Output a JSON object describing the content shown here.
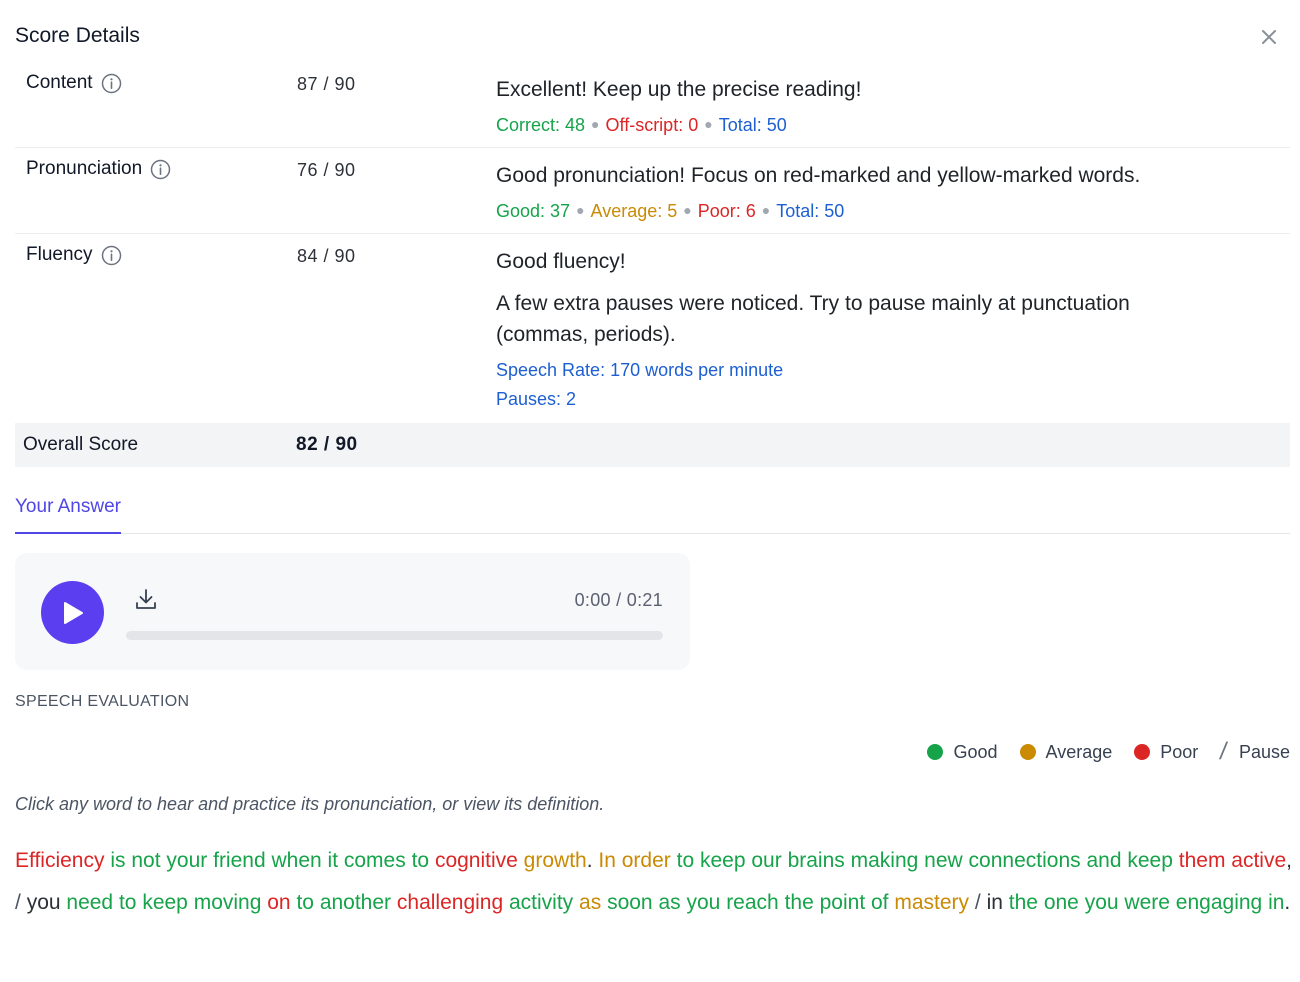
{
  "header": {
    "title": "Score Details",
    "close_icon": "close-icon"
  },
  "rows": {
    "content": {
      "label": "Content",
      "score": "87 / 90",
      "feedback": "Excellent! Keep up the precise reading!",
      "correct": "Correct: 48",
      "offscript": "Off-script: 0",
      "total": "Total: 50"
    },
    "pronunciation": {
      "label": "Pronunciation",
      "score": "76 / 90",
      "feedback": "Good pronunciation! Focus on red-marked and yellow-marked words.",
      "good": "Good: 37",
      "average": "Average: 5",
      "poor": "Poor: 6",
      "total": "Total: 50"
    },
    "fluency": {
      "label": "Fluency",
      "score": "84 / 90",
      "feedback": "Good fluency!",
      "detail": "A few extra pauses were noticed. Try to pause mainly at punctuation (commas, periods).",
      "rate": "Speech Rate: 170 words per minute",
      "pauses": "Pauses: 2"
    }
  },
  "overall": {
    "label": "Overall Score",
    "score": "82 / 90"
  },
  "tabs": {
    "answer": "Your Answer"
  },
  "player": {
    "time": "0:00 / 0:21",
    "progress": 0
  },
  "evaluation": {
    "title": "SPEECH EVALUATION",
    "legend": {
      "good": "Good",
      "average": "Average",
      "poor": "Poor",
      "pause": "Pause"
    },
    "hint": "Click any word to hear and practice its pronunciation, or view its definition."
  },
  "colors": {
    "good": "#16a34a",
    "average": "#ca8a04",
    "poor": "#dc2626",
    "accent": "#5b3ef0",
    "info": "#1d5fd1"
  },
  "passage": [
    {
      "t": "Efficiency",
      "c": "poor"
    },
    {
      "t": " "
    },
    {
      "t": "is",
      "c": "good"
    },
    {
      "t": " "
    },
    {
      "t": "not",
      "c": "good"
    },
    {
      "t": " "
    },
    {
      "t": "your",
      "c": "good"
    },
    {
      "t": " "
    },
    {
      "t": "friend",
      "c": "good"
    },
    {
      "t": " "
    },
    {
      "t": "when",
      "c": "good"
    },
    {
      "t": " "
    },
    {
      "t": "it",
      "c": "good"
    },
    {
      "t": " "
    },
    {
      "t": "comes",
      "c": "good"
    },
    {
      "t": " "
    },
    {
      "t": "to",
      "c": "good"
    },
    {
      "t": " "
    },
    {
      "t": "cognitive",
      "c": "poor"
    },
    {
      "t": " "
    },
    {
      "t": "growth",
      "c": "average"
    },
    {
      "t": "."
    },
    {
      "t": " "
    },
    {
      "t": "In",
      "c": "average"
    },
    {
      "t": " "
    },
    {
      "t": "order",
      "c": "average"
    },
    {
      "t": " "
    },
    {
      "t": "to",
      "c": "good"
    },
    {
      "t": " "
    },
    {
      "t": "keep",
      "c": "good"
    },
    {
      "t": " "
    },
    {
      "t": "our",
      "c": "good"
    },
    {
      "t": " "
    },
    {
      "t": "brains",
      "c": "good"
    },
    {
      "t": " "
    },
    {
      "t": "making",
      "c": "good"
    },
    {
      "t": " "
    },
    {
      "t": "new",
      "c": "good"
    },
    {
      "t": " "
    },
    {
      "t": "connections",
      "c": "good"
    },
    {
      "t": " "
    },
    {
      "t": "and",
      "c": "good"
    },
    {
      "t": " "
    },
    {
      "t": "keep",
      "c": "good"
    },
    {
      "t": " "
    },
    {
      "t": "them",
      "c": "poor"
    },
    {
      "t": " "
    },
    {
      "t": "active",
      "c": "poor"
    },
    {
      "t": ","
    },
    {
      "t": " "
    },
    {
      "t": "/",
      "c": "pause"
    },
    {
      "t": " "
    },
    {
      "t": "you",
      "c": "dark"
    },
    {
      "t": " "
    },
    {
      "t": "need",
      "c": "good"
    },
    {
      "t": " "
    },
    {
      "t": "to",
      "c": "good"
    },
    {
      "t": " "
    },
    {
      "t": "keep",
      "c": "good"
    },
    {
      "t": " "
    },
    {
      "t": "moving",
      "c": "good"
    },
    {
      "t": " "
    },
    {
      "t": "on",
      "c": "poor"
    },
    {
      "t": " "
    },
    {
      "t": "to",
      "c": "good"
    },
    {
      "t": " "
    },
    {
      "t": "another",
      "c": "good"
    },
    {
      "t": " "
    },
    {
      "t": "challenging",
      "c": "poor"
    },
    {
      "t": " "
    },
    {
      "t": "activity",
      "c": "good"
    },
    {
      "t": " "
    },
    {
      "t": "as",
      "c": "average"
    },
    {
      "t": " "
    },
    {
      "t": "soon",
      "c": "good"
    },
    {
      "t": " "
    },
    {
      "t": "as",
      "c": "good"
    },
    {
      "t": " "
    },
    {
      "t": "you",
      "c": "good"
    },
    {
      "t": " "
    },
    {
      "t": "reach",
      "c": "good"
    },
    {
      "t": " "
    },
    {
      "t": "the",
      "c": "good"
    },
    {
      "t": " "
    },
    {
      "t": "point",
      "c": "good"
    },
    {
      "t": " "
    },
    {
      "t": "of",
      "c": "good"
    },
    {
      "t": " "
    },
    {
      "t": "mastery",
      "c": "average"
    },
    {
      "t": " "
    },
    {
      "t": "/",
      "c": "pause"
    },
    {
      "t": " "
    },
    {
      "t": "in",
      "c": "dark"
    },
    {
      "t": " "
    },
    {
      "t": "the",
      "c": "good"
    },
    {
      "t": " "
    },
    {
      "t": "one",
      "c": "good"
    },
    {
      "t": " "
    },
    {
      "t": "you",
      "c": "good"
    },
    {
      "t": " "
    },
    {
      "t": "were",
      "c": "good"
    },
    {
      "t": " "
    },
    {
      "t": "engaging",
      "c": "good"
    },
    {
      "t": " "
    },
    {
      "t": "in",
      "c": "good"
    },
    {
      "t": "."
    }
  ]
}
